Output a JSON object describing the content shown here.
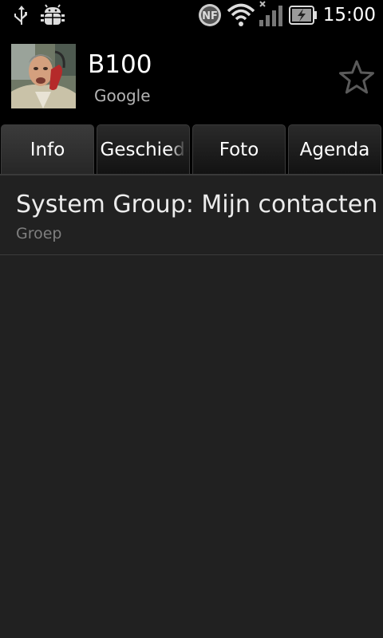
{
  "status_bar": {
    "time": "15:00",
    "icons": [
      "usb-icon",
      "android-debug-icon",
      "nfc-icon",
      "wifi-icon",
      "cell-signal-off-icon",
      "battery-charging-icon"
    ]
  },
  "contact": {
    "name": "B100",
    "account": "Google",
    "starred": false
  },
  "tabs": [
    {
      "label": "Info",
      "selected": true
    },
    {
      "label": "Geschiedenis",
      "selected": false
    },
    {
      "label": "Foto",
      "selected": false
    },
    {
      "label": "Agenda",
      "selected": false
    }
  ],
  "details": [
    {
      "value": "System Group: Mijn contacten",
      "label": "Groep"
    }
  ]
}
